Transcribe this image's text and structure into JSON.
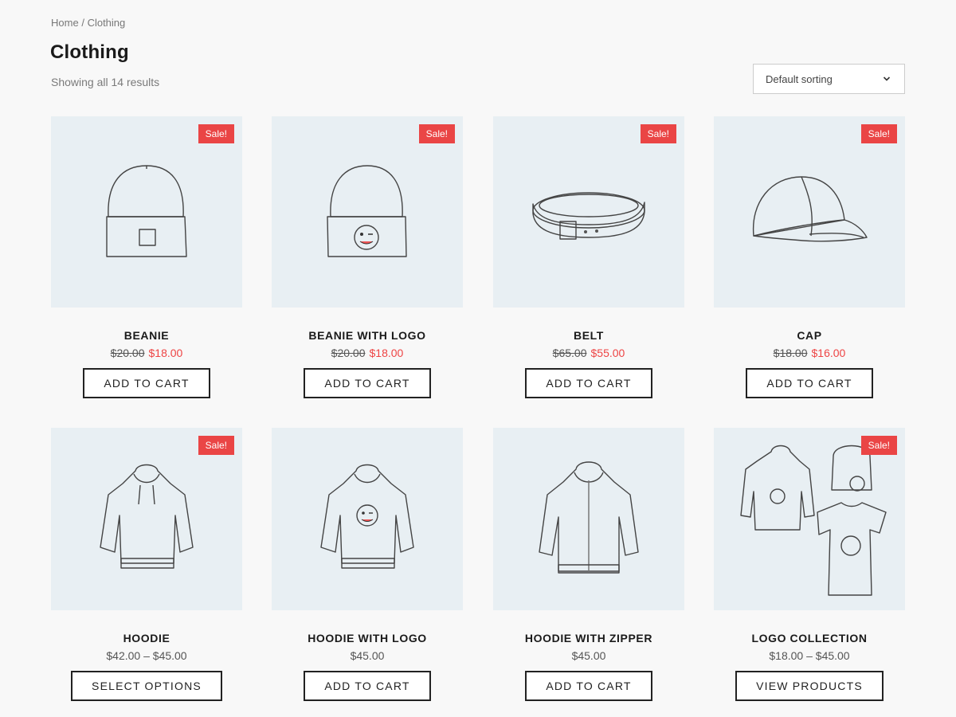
{
  "breadcrumb": {
    "home": "Home",
    "separator": "/",
    "current": "Clothing"
  },
  "page_title": "Clothing",
  "result_count": "Showing all 14 results",
  "sorting": {
    "selected": "Default sorting",
    "icon": "chevron-down-icon"
  },
  "colors": {
    "sale_badge": "#ea4545",
    "sale_price": "#e44444",
    "thumb_bg": "#e8eff3"
  },
  "products": [
    {
      "name": "Beanie",
      "sale_label": "Sale!",
      "old_price": "$20.00",
      "price": "$18.00",
      "button": "Add to cart"
    },
    {
      "name": "Beanie with Logo",
      "sale_label": "Sale!",
      "old_price": "$20.00",
      "price": "$18.00",
      "button": "Add to cart"
    },
    {
      "name": "Belt",
      "sale_label": "Sale!",
      "old_price": "$65.00",
      "price": "$55.00",
      "button": "Add to cart"
    },
    {
      "name": "Cap",
      "sale_label": "Sale!",
      "old_price": "$18.00",
      "price": "$16.00",
      "button": "Add to cart"
    },
    {
      "name": "Hoodie",
      "sale_label": "Sale!",
      "price": "$42.00 – $45.00",
      "button": "Select options"
    },
    {
      "name": "Hoodie with Logo",
      "price": "$45.00",
      "button": "Add to cart"
    },
    {
      "name": "Hoodie with Zipper",
      "price": "$45.00",
      "button": "Add to cart"
    },
    {
      "name": "Logo Collection",
      "sale_label": "Sale!",
      "price": "$18.00 – $45.00",
      "button": "View products"
    }
  ]
}
